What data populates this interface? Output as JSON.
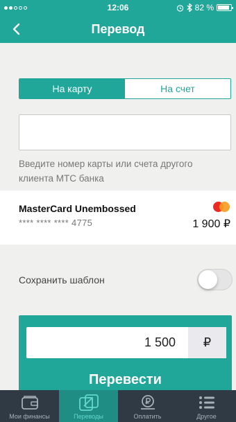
{
  "status_bar": {
    "time": "12:06",
    "battery_percent": "82 %",
    "icons": [
      "signal-dots-icon",
      "alarm-icon",
      "bluetooth-icon",
      "battery-icon"
    ]
  },
  "nav": {
    "title": "Перевод",
    "back_icon": "chevron-left-icon"
  },
  "segment": {
    "active_label": "На карту",
    "inactive_label": "На счет"
  },
  "card_input": {
    "value": "",
    "hint": "Введите номер карты или счета другого клиента МТС банка"
  },
  "card": {
    "name": "MasterCard Unembossed",
    "mask": "**** **** **** 4775",
    "balance": "1 900 ₽",
    "logo": "mastercard-logo-icon"
  },
  "save_template": {
    "label": "Сохранить шаблон",
    "enabled": false
  },
  "transfer": {
    "amount": "1 500",
    "currency": "₽",
    "button_label": "Перевести"
  },
  "tabs": [
    {
      "label": "Мои финансы",
      "icon": "wallet-icon",
      "active": false
    },
    {
      "label": "Переводы",
      "icon": "transfer-icon",
      "active": true
    },
    {
      "label": "Оплатить",
      "icon": "ruble-hand-icon",
      "active": false
    },
    {
      "label": "Другое",
      "icon": "menu-list-icon",
      "active": false
    }
  ],
  "colors": {
    "accent": "#21a69a",
    "tab_bar": "#2f3a44",
    "tab_active": "#1f8d84"
  }
}
